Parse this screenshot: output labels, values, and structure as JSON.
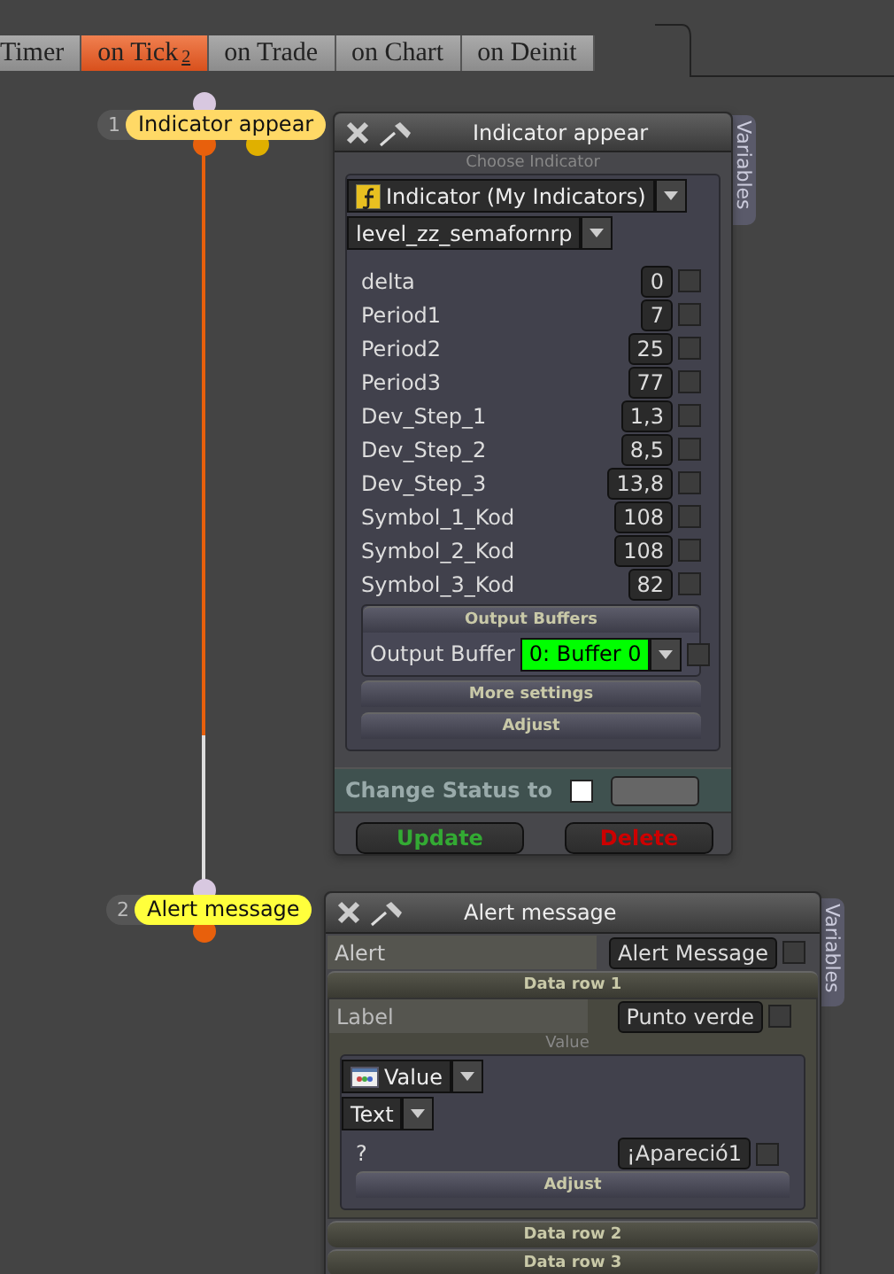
{
  "tabs": [
    {
      "label": "Timer",
      "selected": false
    },
    {
      "label": "on Tick",
      "badge": "2",
      "selected": true
    },
    {
      "label": "on Trade",
      "selected": false
    },
    {
      "label": "on Chart",
      "selected": false
    },
    {
      "label": "on Deinit",
      "selected": false
    }
  ],
  "nodes": [
    {
      "number": "1",
      "label": "Indicator appear",
      "color": "#ffd966"
    },
    {
      "number": "2",
      "label": "Alert message",
      "color": "#ffff3c"
    }
  ],
  "indicator_panel": {
    "title": "Indicator appear",
    "variables_tab": "Variables",
    "choose_label": "Choose Indicator",
    "indicator_select": "Indicator (My Indicators)",
    "name_select": "level_zz_semafornrp",
    "params": [
      {
        "name": "delta",
        "value": "0",
        "checked": false
      },
      {
        "name": "Period1",
        "value": "7",
        "checked": false
      },
      {
        "name": "Period2",
        "value": "25",
        "checked": false
      },
      {
        "name": "Period3",
        "value": "77",
        "checked": false
      },
      {
        "name": "Dev_Step_1",
        "value": "1,3",
        "checked": false
      },
      {
        "name": "Dev_Step_2",
        "value": "8,5",
        "checked": false
      },
      {
        "name": "Dev_Step_3",
        "value": "13,8",
        "checked": false
      },
      {
        "name": "Symbol_1_Kod",
        "value": "108",
        "checked": false
      },
      {
        "name": "Symbol_2_Kod",
        "value": "108",
        "checked": false
      },
      {
        "name": "Symbol_3_Kod",
        "value": "82",
        "checked": false
      }
    ],
    "output_buffers": {
      "heading": "Output Buffers",
      "label": "Output Buffer",
      "value": "0: Buffer 0",
      "checked": false
    },
    "more_settings": "More settings",
    "adjust": "Adjust",
    "change_status_label": "Change Status to",
    "buttons": [
      {
        "label": "Update",
        "kind": "update"
      },
      {
        "label": "Delete",
        "kind": "delete"
      }
    ]
  },
  "alert_panel": {
    "title": "Alert message",
    "variables_tab": "Variables",
    "alert": {
      "label": "Alert",
      "value": "Alert Message",
      "checked": false
    },
    "data_rows": [
      {
        "title": "Data row 1",
        "expanded": true,
        "field": {
          "label": "Label",
          "value": "Punto verde",
          "checked": false
        },
        "value_heading": "Value",
        "value_select": "Value",
        "type_select": "Text",
        "question": {
          "label": "?",
          "value": "¡Apareció1",
          "checked": false
        },
        "adjust": "Adjust"
      },
      {
        "title": "Data row 2",
        "expanded": false
      },
      {
        "title": "Data row 3",
        "expanded": false
      }
    ]
  }
}
